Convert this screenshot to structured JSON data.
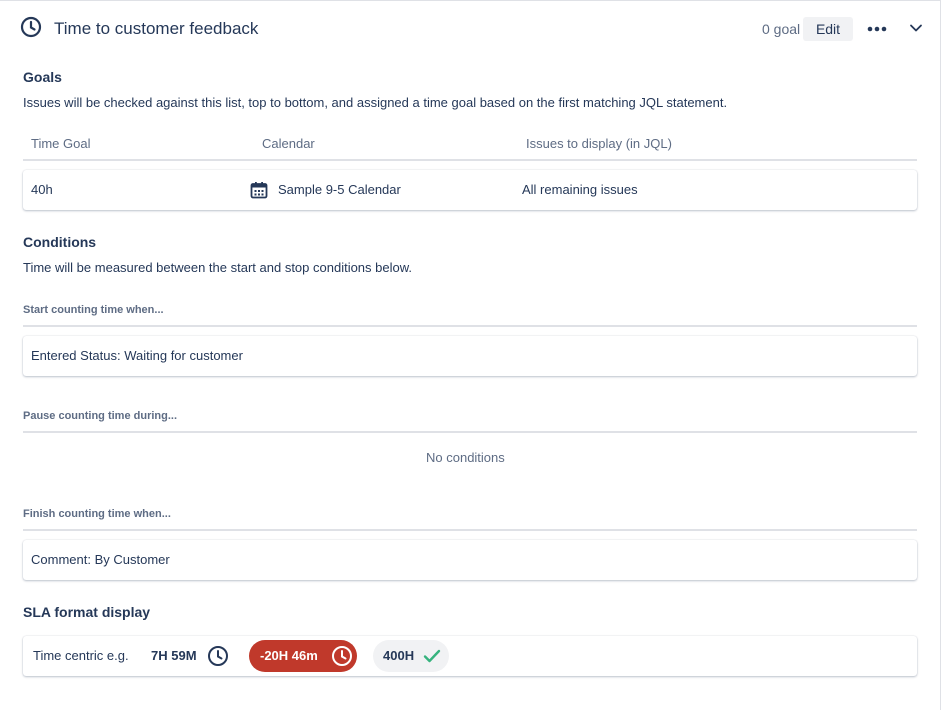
{
  "header": {
    "title": "Time to customer feedback",
    "goal_count": "0 goal",
    "edit_label": "Edit"
  },
  "goals": {
    "heading": "Goals",
    "description": "Issues will be checked against this list, top to bottom, and assigned a time goal based on the first matching JQL statement.",
    "columns": [
      "Time Goal",
      "Calendar",
      "Issues to display (in JQL)"
    ],
    "rows": [
      {
        "time_goal": "40h",
        "calendar": "Sample 9-5 Calendar",
        "issues": "All remaining issues"
      }
    ]
  },
  "conditions": {
    "heading": "Conditions",
    "description": "Time will be measured between the start and stop conditions below.",
    "start_label": "Start counting time when...",
    "start_value": "Entered Status: Waiting for customer",
    "pause_label": "Pause counting time during...",
    "pause_value": "No conditions",
    "finish_label": "Finish counting time when...",
    "finish_value": "Comment: By Customer"
  },
  "sla_format": {
    "heading": "SLA format display",
    "label": "Time centric e.g.",
    "example_ok": "7H 59M",
    "example_breached": "-20H 46m",
    "example_done": "400H"
  },
  "icons": {
    "header": "clock-icon",
    "calendar": "calendar-icon",
    "more": "more-icon",
    "collapse": "chevron-down-icon",
    "done": "check-icon"
  },
  "colors": {
    "breached": "#c0392b",
    "done_check": "#36b37e",
    "text": "#253858"
  }
}
